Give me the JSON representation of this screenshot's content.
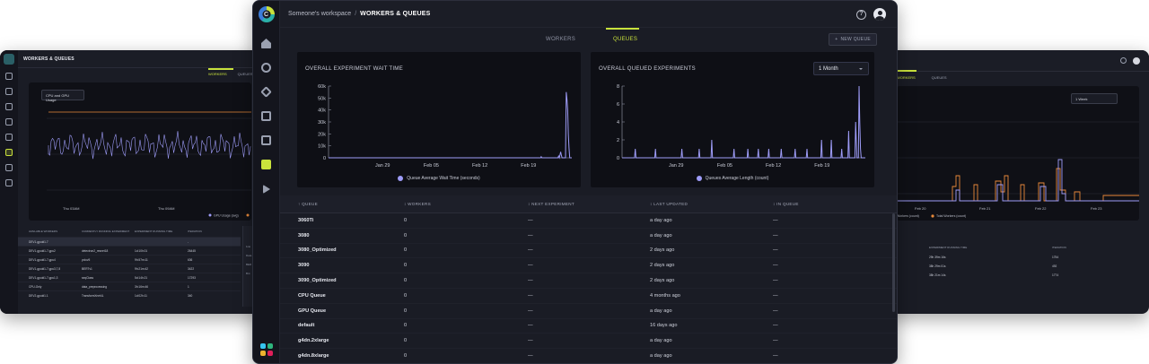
{
  "left_window": {
    "title": "WORKERS & QUEUES",
    "tabs": [
      "WORKERS",
      "QUEUES"
    ],
    "select": "CPU and GPU Usage",
    "x_ticks": [
      "Thu 03AM",
      "Thu 09AM"
    ],
    "legend": "GPU Usage (avg)",
    "table_headers": [
      "AVAILABLE WORKERS",
      "CURRENTLY RUNNING EXPERIMENT",
      "EXPERIMENT RUNNING TIME",
      "ITERATION"
    ],
    "rows": [
      [
        "DEV1-gpuid1.7",
        "",
        "",
        "-"
      ],
      [
        "DEV1-gpuid1-7.gpu2",
        "detectron2_resnet18",
        "1d:10h:01",
        "26445"
      ],
      [
        "DEV1-gpuid1-7.gpu4",
        "yolov5",
        "9h:57m:11",
        "636"
      ],
      [
        "DEV1-gpuid1-7.gpu3,7,8",
        "BERTv1",
        "9h:21m:42",
        "3422"
      ],
      [
        "DEV1-gpuid1-7.gpu1,3",
        "seqClass",
        "5d:14h:21",
        "17293"
      ],
      [
        "CPU-Only",
        "data_preprocessing",
        "3h:16m:46",
        "1"
      ],
      [
        "DEV2-gpuid1.1",
        "TransformXnet4L",
        "1d:02h:11",
        "340"
      ]
    ],
    "side_labels": [
      "1rai",
      "Data",
      "BER",
      "Bnt"
    ]
  },
  "right_window": {
    "tabs": [
      "WORKERS",
      "QUEUES"
    ],
    "select": "1 Week",
    "x_ticks": [
      "Feb 20",
      "Feb 21",
      "Feb 22",
      "Feb 23"
    ],
    "legend": [
      "Workers (count)",
      "Total Workers (count)"
    ],
    "table_headers": [
      "EXPERIMENT RUNNING TIME",
      "ITERATION"
    ],
    "rows": [
      [
        "29h 39m 16s",
        "1754"
      ],
      [
        "38h 29m 01s",
        "492"
      ],
      [
        "38h 21m 14s",
        "1774"
      ]
    ]
  },
  "main": {
    "breadcrumb": {
      "workspace": "Someone's workspace",
      "separator": "/",
      "current": "WORKERS & QUEUES"
    },
    "tabs": {
      "workers": "WORKERS",
      "queues": "QUEUES"
    },
    "new_queue_label": "NEW QUEUE",
    "charts": {
      "wait_title": "OVERALL EXPERIMENT WAIT TIME",
      "wait_legend": "Queue Average Wait Time (seconds)",
      "queued_title": "OVERALL QUEUED EXPERIMENTS",
      "queued_legend": "Queues Average Length (count)",
      "range_select": "1 Month",
      "wait_y_ticks": [
        "60k",
        "50k",
        "40k",
        "30k",
        "20k",
        "10k",
        "0"
      ],
      "queued_y_ticks": [
        "8",
        "6",
        "4",
        "2",
        "0"
      ],
      "x_ticks": [
        "Jan 29",
        "Feb 05",
        "Feb 12",
        "Feb 19"
      ]
    },
    "table": {
      "headers": {
        "queue": "↑ QUEUE",
        "workers": "↕ WORKERS",
        "next": "↕ NEXT EXPERIMENT",
        "updated": "↕ LAST UPDATED",
        "in_queue": "↕ IN QUEUE"
      },
      "rows": [
        {
          "queue": "3060Ti",
          "workers": "0",
          "next": "—",
          "updated": "a day ago",
          "in_queue": "—"
        },
        {
          "queue": "3080",
          "workers": "0",
          "next": "—",
          "updated": "a day ago",
          "in_queue": "—"
        },
        {
          "queue": "3080_Optimized",
          "workers": "0",
          "next": "—",
          "updated": "2 days ago",
          "in_queue": "—"
        },
        {
          "queue": "3090",
          "workers": "0",
          "next": "—",
          "updated": "2 days ago",
          "in_queue": "—"
        },
        {
          "queue": "3090_Optimized",
          "workers": "0",
          "next": "—",
          "updated": "2 days ago",
          "in_queue": "—"
        },
        {
          "queue": "CPU Queue",
          "workers": "0",
          "next": "—",
          "updated": "4 months ago",
          "in_queue": "—"
        },
        {
          "queue": "GPU Queue",
          "workers": "0",
          "next": "—",
          "updated": "a day ago",
          "in_queue": "—"
        },
        {
          "queue": "default",
          "workers": "0",
          "next": "—",
          "updated": "16 days ago",
          "in_queue": "—"
        },
        {
          "queue": "g4dn.2xlarge",
          "workers": "0",
          "next": "—",
          "updated": "a day ago",
          "in_queue": "—"
        },
        {
          "queue": "g4dn.8xlarge",
          "workers": "0",
          "next": "—",
          "updated": "a day ago",
          "in_queue": "—"
        }
      ]
    }
  },
  "colors": {
    "accent": "#c9e23c",
    "series": "#9e9cf8",
    "orange": "#e8893a",
    "bg": "#1a1c25",
    "chart_bg": "#0e0f15"
  },
  "chart_data": [
    {
      "type": "line",
      "title": "OVERALL EXPERIMENT WAIT TIME",
      "xlabel": "",
      "ylabel": "",
      "x_ticks": [
        "Jan 29",
        "Feb 05",
        "Feb 12",
        "Feb 19"
      ],
      "ylim": [
        0,
        60000
      ],
      "series": [
        {
          "name": "Queue Average Wait Time (seconds)",
          "points": [
            [
              0,
              0
            ],
            [
              100,
              0
            ],
            [
              200,
              0
            ],
            [
              290,
              0
            ],
            [
              300,
              0
            ],
            [
              305,
              0
            ],
            [
              306,
              1000
            ],
            [
              307,
              0
            ],
            [
              315,
              0
            ],
            [
              326,
              0
            ],
            [
              330,
              0
            ],
            [
              331,
              1500
            ],
            [
              332,
              0
            ],
            [
              334,
              5000
            ],
            [
              335,
              2000
            ],
            [
              336,
              0
            ],
            [
              341,
              0
            ],
            [
              342,
              55000
            ],
            [
              343,
              49000
            ],
            [
              344,
              40000
            ],
            [
              345,
              20000
            ],
            [
              346,
              8000
            ],
            [
              347,
              0
            ],
            [
              350,
              0
            ]
          ]
        }
      ]
    },
    {
      "type": "line",
      "title": "OVERALL QUEUED EXPERIMENTS",
      "xlabel": "",
      "ylabel": "",
      "x_ticks": [
        "Jan 29",
        "Feb 05",
        "Feb 12",
        "Feb 19"
      ],
      "ylim": [
        0,
        8
      ],
      "series": [
        {
          "name": "Queues Average Length (count)",
          "points": [
            [
              0,
              0
            ],
            [
              18,
              0
            ],
            [
              19,
              1
            ],
            [
              20,
              0
            ],
            [
              47,
              0
            ],
            [
              48,
              1
            ],
            [
              49,
              0
            ],
            [
              85,
              0
            ],
            [
              86,
              1
            ],
            [
              87,
              0
            ],
            [
              110,
              0
            ],
            [
              111,
              1
            ],
            [
              112,
              0
            ],
            [
              128,
              0
            ],
            [
              129,
              2
            ],
            [
              130,
              0
            ],
            [
              160,
              0
            ],
            [
              161,
              1
            ],
            [
              162,
              0
            ],
            [
              180,
              0
            ],
            [
              181,
              1
            ],
            [
              182,
              0
            ],
            [
              195,
              0
            ],
            [
              196,
              1
            ],
            [
              197,
              0
            ],
            [
              210,
              0
            ],
            [
              211,
              1
            ],
            [
              212,
              0
            ],
            [
              228,
              0
            ],
            [
              229,
              1
            ],
            [
              230,
              0
            ],
            [
              248,
              0
            ],
            [
              249,
              1
            ],
            [
              250,
              0
            ],
            [
              265,
              0
            ],
            [
              266,
              1
            ],
            [
              267,
              0
            ],
            [
              286,
              0
            ],
            [
              287,
              2
            ],
            [
              288,
              0
            ],
            [
              300,
              0
            ],
            [
              301,
              2
            ],
            [
              302,
              0
            ],
            [
              315,
              0
            ],
            [
              316,
              1
            ],
            [
              317,
              0
            ],
            [
              325,
              0
            ],
            [
              326,
              3
            ],
            [
              327,
              0
            ],
            [
              335,
              0
            ],
            [
              336,
              4
            ],
            [
              337,
              2
            ],
            [
              338,
              0
            ],
            [
              340,
              0
            ],
            [
              341,
              8
            ],
            [
              342,
              4
            ],
            [
              343,
              1
            ],
            [
              344,
              0
            ],
            [
              350,
              0
            ]
          ]
        }
      ]
    }
  ]
}
